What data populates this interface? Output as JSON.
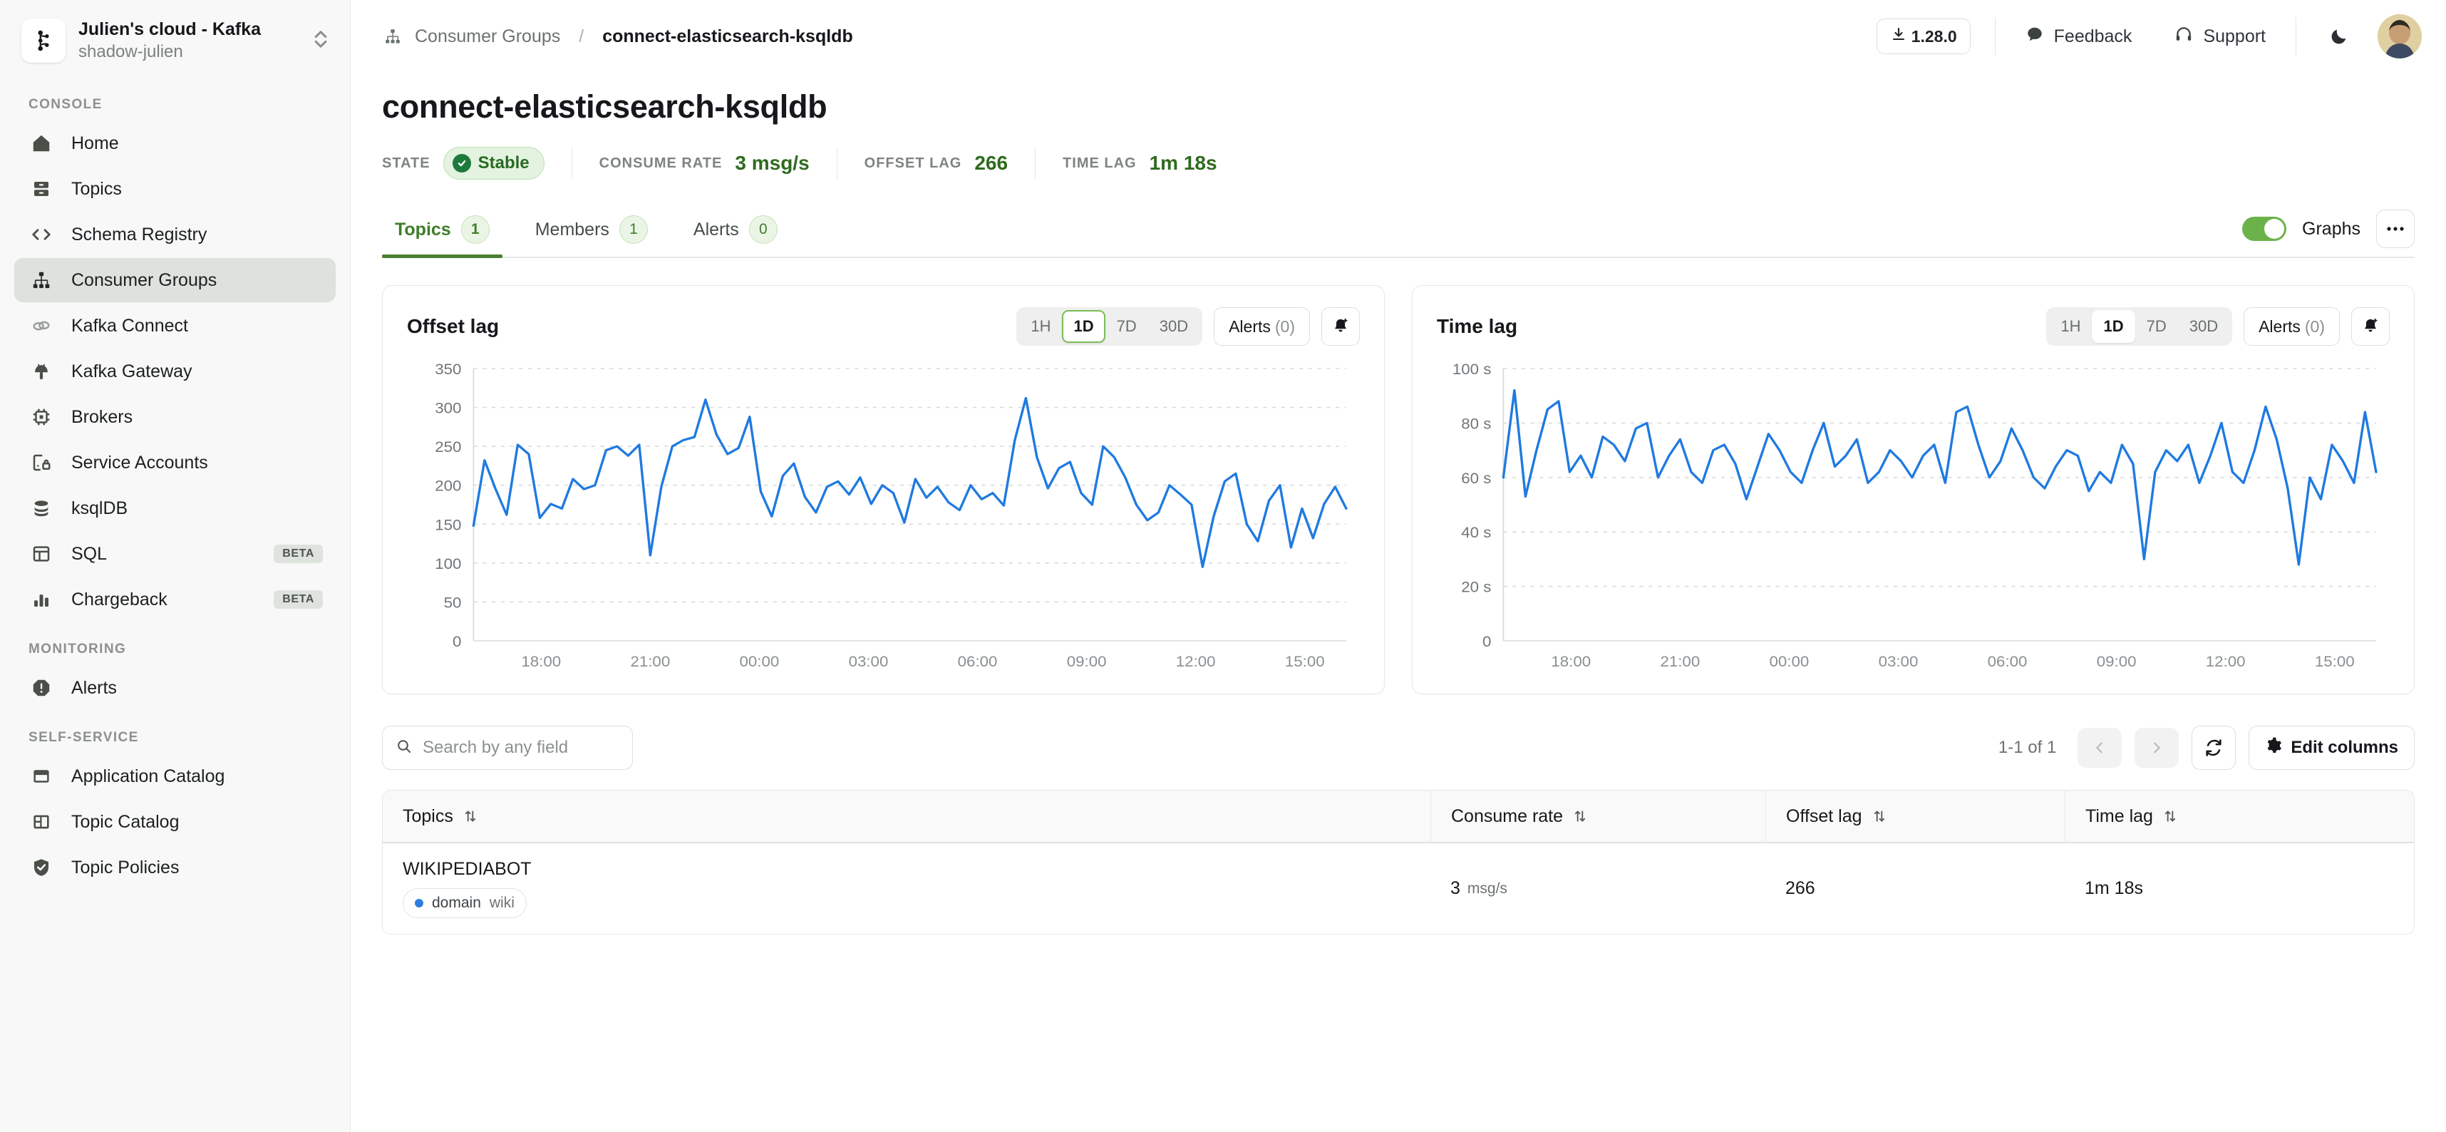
{
  "sidebar": {
    "org": {
      "name": "Julien's cloud - Kafka",
      "sub": "shadow-julien",
      "logo_icon": "kafka-logo-icon",
      "switch_icon": "chevron-up-down-icon"
    },
    "sections": [
      {
        "label": "CONSOLE",
        "items": [
          {
            "label": "Home",
            "icon": "home-icon",
            "active": false,
            "badge": ""
          },
          {
            "label": "Topics",
            "icon": "topics-icon",
            "active": false,
            "badge": ""
          },
          {
            "label": "Schema Registry",
            "icon": "code-brackets-icon",
            "active": false,
            "badge": ""
          },
          {
            "label": "Consumer Groups",
            "icon": "consumer-groups-icon",
            "active": true,
            "badge": ""
          },
          {
            "label": "Kafka Connect",
            "icon": "link-icon",
            "active": false,
            "badge": ""
          },
          {
            "label": "Kafka Gateway",
            "icon": "gateway-icon",
            "active": false,
            "badge": ""
          },
          {
            "label": "Brokers",
            "icon": "chip-icon",
            "active": false,
            "badge": ""
          },
          {
            "label": "Service Accounts",
            "icon": "service-account-lock-icon",
            "active": false,
            "badge": ""
          },
          {
            "label": "ksqlDB",
            "icon": "database-icon",
            "active": false,
            "badge": ""
          },
          {
            "label": "SQL",
            "icon": "table-icon",
            "active": false,
            "badge": "BETA"
          },
          {
            "label": "Chargeback",
            "icon": "bar-chart-icon",
            "active": false,
            "badge": "BETA"
          }
        ]
      },
      {
        "label": "MONITORING",
        "items": [
          {
            "label": "Alerts",
            "icon": "alert-octagon-icon",
            "active": false,
            "badge": ""
          }
        ]
      },
      {
        "label": "SELF-SERVICE",
        "items": [
          {
            "label": "Application Catalog",
            "icon": "window-icon",
            "active": false,
            "badge": ""
          },
          {
            "label": "Topic Catalog",
            "icon": "layout-icon",
            "active": false,
            "badge": ""
          },
          {
            "label": "Topic Policies",
            "icon": "shield-check-icon",
            "active": false,
            "badge": ""
          }
        ]
      }
    ]
  },
  "topbar": {
    "breadcrumb_icon": "consumer-groups-icon",
    "breadcrumb_parent": "Consumer Groups",
    "breadcrumb_sep": "/",
    "breadcrumb_current": "connect-elasticsearch-ksqldb",
    "version": "1.28.0",
    "version_icon": "download-icon",
    "feedback": "Feedback",
    "feedback_icon": "comment-icon",
    "support": "Support",
    "support_icon": "headset-icon",
    "theme_icon": "moon-icon",
    "avatar_name": "avatar"
  },
  "page": {
    "title": "connect-elasticsearch-ksqldb",
    "stats": [
      {
        "label": "STATE",
        "value": "Stable",
        "type": "pill"
      },
      {
        "label": "CONSUME RATE",
        "value": "3 msg/s",
        "type": "text"
      },
      {
        "label": "OFFSET LAG",
        "value": "266",
        "type": "text"
      },
      {
        "label": "TIME LAG",
        "value": "1m 18s",
        "type": "text"
      }
    ]
  },
  "tabs": {
    "items": [
      {
        "label": "Topics",
        "count": "1",
        "active": true
      },
      {
        "label": "Members",
        "count": "1",
        "active": false
      },
      {
        "label": "Alerts",
        "count": "0",
        "active": false
      }
    ],
    "graphs_label": "Graphs",
    "graphs_on": true,
    "more_label": "•••"
  },
  "chart_data": [
    {
      "type": "line",
      "title": "Offset lag",
      "xlabel": "",
      "ylabel": "",
      "ylim": [
        0,
        350
      ],
      "yticks": [
        0,
        50,
        100,
        150,
        200,
        250,
        300,
        350
      ],
      "ytick_labels": [
        "0",
        "50",
        "100",
        "150",
        "200",
        "250",
        "300",
        "350"
      ],
      "xtick_labels": [
        "18:00",
        "21:00",
        "00:00",
        "03:00",
        "06:00",
        "09:00",
        "12:00",
        "15:00"
      ],
      "grid": true,
      "legend": "none",
      "series": [
        {
          "name": "Offset lag",
          "color": "#1f7ae0",
          "values": [
            148,
            232,
            195,
            162,
            252,
            240,
            158,
            176,
            170,
            208,
            195,
            200,
            245,
            250,
            238,
            252,
            110,
            198,
            250,
            258,
            262,
            310,
            265,
            240,
            248,
            288,
            192,
            160,
            212,
            228,
            185,
            165,
            198,
            205,
            188,
            210,
            176,
            200,
            190,
            152,
            208,
            184,
            198,
            178,
            168,
            200,
            182,
            190,
            174,
            258,
            312,
            236,
            196,
            222,
            230,
            190,
            175,
            250,
            236,
            210,
            175,
            155,
            165,
            200,
            188,
            175,
            95,
            160,
            205,
            215,
            150,
            128,
            180,
            200,
            120,
            170,
            132,
            176,
            198,
            170
          ]
        }
      ],
      "controls": {
        "ranges": [
          "1H",
          "1D",
          "7D",
          "30D"
        ],
        "selected_range": "1D",
        "focused_range": "1D",
        "alerts_label": "Alerts",
        "alerts_count": "(0)",
        "bell_icon": "bell-plus-icon"
      }
    },
    {
      "type": "line",
      "title": "Time lag",
      "xlabel": "",
      "ylabel": "",
      "ylim": [
        0,
        100
      ],
      "yticks": [
        0,
        20,
        40,
        60,
        80,
        100
      ],
      "ytick_labels": [
        "0",
        "20 s",
        "40 s",
        "60 s",
        "80 s",
        "100 s"
      ],
      "xtick_labels": [
        "18:00",
        "21:00",
        "00:00",
        "03:00",
        "06:00",
        "09:00",
        "12:00",
        "15:00"
      ],
      "grid": true,
      "legend": "none",
      "series": [
        {
          "name": "Time lag",
          "color": "#1f7ae0",
          "values": [
            60,
            92,
            53,
            70,
            85,
            88,
            62,
            68,
            60,
            75,
            72,
            66,
            78,
            80,
            60,
            68,
            74,
            62,
            58,
            70,
            72,
            65,
            52,
            64,
            76,
            70,
            62,
            58,
            70,
            80,
            64,
            68,
            74,
            58,
            62,
            70,
            66,
            60,
            68,
            72,
            58,
            84,
            86,
            72,
            60,
            66,
            78,
            70,
            60,
            56,
            64,
            70,
            68,
            55,
            62,
            58,
            72,
            65,
            30,
            62,
            70,
            66,
            72,
            58,
            68,
            80,
            62,
            58,
            70,
            86,
            74,
            56,
            28,
            60,
            52,
            72,
            66,
            58,
            84,
            62
          ]
        }
      ],
      "controls": {
        "ranges": [
          "1H",
          "1D",
          "7D",
          "30D"
        ],
        "selected_range": "1D",
        "focused_range": "",
        "alerts_label": "Alerts",
        "alerts_count": "(0)",
        "bell_icon": "bell-plus-icon"
      }
    }
  ],
  "toolbar": {
    "search_placeholder": "Search by any field",
    "search_value": "",
    "search_icon": "search-icon",
    "page_count": "1-1 of 1",
    "prev_icon": "chevron-left-icon",
    "next_icon": "chevron-right-icon",
    "refresh_icon": "refresh-icon",
    "edit_columns": "Edit columns",
    "edit_columns_icon": "gear-icon"
  },
  "table": {
    "columns": [
      {
        "label": "Topics",
        "sortable": true
      },
      {
        "label": "Consume rate",
        "sortable": true
      },
      {
        "label": "Offset lag",
        "sortable": true
      },
      {
        "label": "Time lag",
        "sortable": true
      }
    ],
    "rows": [
      {
        "topic": "WIKIPEDIABOT",
        "tag_key": "domain",
        "tag_value": "wiki",
        "consume_rate": "3",
        "consume_rate_unit": "msg/s",
        "offset_lag": "266",
        "time_lag": "1m 18s"
      }
    ]
  }
}
